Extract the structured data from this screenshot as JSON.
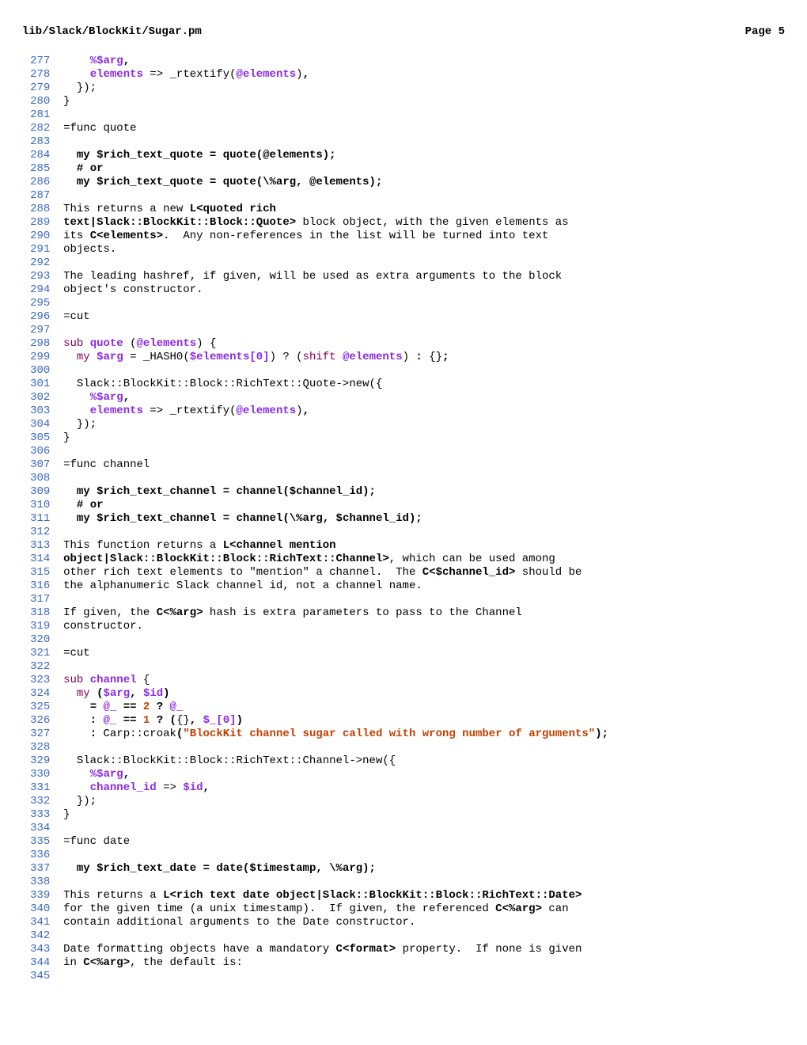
{
  "header": {
    "filepath": "lib/Slack/BlockKit/Sugar.pm",
    "page_label": "Page 5"
  },
  "lines": [
    {
      "n": 277,
      "segs": [
        {
          "t": "    "
        },
        {
          "c": "var",
          "t": "%$arg"
        },
        {
          "c": "bop",
          "t": ","
        }
      ]
    },
    {
      "n": 278,
      "segs": [
        {
          "t": "    "
        },
        {
          "c": "var",
          "t": "elements"
        },
        {
          "t": " => _rtextify("
        },
        {
          "c": "var",
          "t": "@elements"
        },
        {
          "t": ")"
        },
        {
          "c": "bop",
          "t": ","
        }
      ]
    },
    {
      "n": 279,
      "segs": [
        {
          "t": "  });"
        }
      ]
    },
    {
      "n": 280,
      "segs": [
        {
          "t": "}"
        }
      ]
    },
    {
      "n": 281,
      "segs": [
        {
          "t": ""
        }
      ]
    },
    {
      "n": 282,
      "segs": [
        {
          "t": "=func quote"
        }
      ]
    },
    {
      "n": 283,
      "segs": [
        {
          "t": ""
        }
      ]
    },
    {
      "n": 284,
      "segs": [
        {
          "t": "  "
        },
        {
          "c": "podb",
          "t": "my $rich_text_quote = quote(@elements);"
        }
      ]
    },
    {
      "n": 285,
      "segs": [
        {
          "t": "  "
        },
        {
          "c": "podb",
          "t": "# or"
        }
      ]
    },
    {
      "n": 286,
      "segs": [
        {
          "t": "  "
        },
        {
          "c": "podb",
          "t": "my $rich_text_quote = quote(\\%arg, @elements);"
        }
      ]
    },
    {
      "n": 287,
      "segs": [
        {
          "t": ""
        }
      ]
    },
    {
      "n": 288,
      "segs": [
        {
          "t": "This returns a new "
        },
        {
          "c": "podb",
          "t": "L<quoted rich"
        }
      ]
    },
    {
      "n": 289,
      "segs": [
        {
          "c": "podb",
          "t": "text|Slack::BlockKit::Block::Quote>"
        },
        {
          "t": " block object, with the given elements as"
        }
      ]
    },
    {
      "n": 290,
      "segs": [
        {
          "t": "its "
        },
        {
          "c": "podb",
          "t": "C<elements>"
        },
        {
          "t": ".  Any non-references in the list will be turned into text"
        }
      ]
    },
    {
      "n": 291,
      "segs": [
        {
          "t": "objects."
        }
      ]
    },
    {
      "n": 292,
      "segs": [
        {
          "t": ""
        }
      ]
    },
    {
      "n": 293,
      "segs": [
        {
          "t": "The leading hashref, if given, will be used as extra arguments to the block"
        }
      ]
    },
    {
      "n": 294,
      "segs": [
        {
          "t": "object's constructor."
        }
      ]
    },
    {
      "n": 295,
      "segs": [
        {
          "t": ""
        }
      ]
    },
    {
      "n": 296,
      "segs": [
        {
          "t": "=cut"
        }
      ]
    },
    {
      "n": 297,
      "segs": [
        {
          "t": ""
        }
      ]
    },
    {
      "n": 298,
      "segs": [
        {
          "c": "kw",
          "t": "sub "
        },
        {
          "c": "var",
          "t": "quote"
        },
        {
          "t": " ("
        },
        {
          "c": "var",
          "t": "@elements"
        },
        {
          "t": ") {"
        }
      ]
    },
    {
      "n": 299,
      "segs": [
        {
          "t": "  "
        },
        {
          "c": "kw",
          "t": "my"
        },
        {
          "t": " "
        },
        {
          "c": "var",
          "t": "$arg"
        },
        {
          "t": " = _HASH0("
        },
        {
          "c": "var",
          "t": "$elements[0]"
        },
        {
          "t": ") ? ("
        },
        {
          "c": "kw",
          "t": "shift"
        },
        {
          "t": " "
        },
        {
          "c": "var",
          "t": "@elements"
        },
        {
          "t": ")"
        },
        {
          "c": "bop",
          "t": " : "
        },
        {
          "t": "{}"
        },
        {
          "c": "bop",
          "t": ";"
        }
      ]
    },
    {
      "n": 300,
      "segs": [
        {
          "t": ""
        }
      ]
    },
    {
      "n": 301,
      "segs": [
        {
          "t": "  Slack::BlockKit::Block::RichText::Quote->new({"
        }
      ]
    },
    {
      "n": 302,
      "segs": [
        {
          "t": "    "
        },
        {
          "c": "var",
          "t": "%$arg"
        },
        {
          "c": "bop",
          "t": ","
        }
      ]
    },
    {
      "n": 303,
      "segs": [
        {
          "t": "    "
        },
        {
          "c": "var",
          "t": "elements"
        },
        {
          "t": " => _rtextify("
        },
        {
          "c": "var",
          "t": "@elements"
        },
        {
          "t": ")"
        },
        {
          "c": "bop",
          "t": ","
        }
      ]
    },
    {
      "n": 304,
      "segs": [
        {
          "t": "  });"
        }
      ]
    },
    {
      "n": 305,
      "segs": [
        {
          "t": "}"
        }
      ]
    },
    {
      "n": 306,
      "segs": [
        {
          "t": ""
        }
      ]
    },
    {
      "n": 307,
      "segs": [
        {
          "t": "=func channel"
        }
      ]
    },
    {
      "n": 308,
      "segs": [
        {
          "t": ""
        }
      ]
    },
    {
      "n": 309,
      "segs": [
        {
          "t": "  "
        },
        {
          "c": "podb",
          "t": "my $rich_text_channel = channel($channel_id);"
        }
      ]
    },
    {
      "n": 310,
      "segs": [
        {
          "t": "  "
        },
        {
          "c": "podb",
          "t": "# or"
        }
      ]
    },
    {
      "n": 311,
      "segs": [
        {
          "t": "  "
        },
        {
          "c": "podb",
          "t": "my $rich_text_channel = channel(\\%arg, $channel_id);"
        }
      ]
    },
    {
      "n": 312,
      "segs": [
        {
          "t": ""
        }
      ]
    },
    {
      "n": 313,
      "segs": [
        {
          "t": "This function returns a "
        },
        {
          "c": "podb",
          "t": "L<channel mention"
        }
      ]
    },
    {
      "n": 314,
      "segs": [
        {
          "c": "podb",
          "t": "object|Slack::BlockKit::Block::RichText::Channel>"
        },
        {
          "t": ", which can be used among"
        }
      ]
    },
    {
      "n": 315,
      "segs": [
        {
          "t": "other rich text elements to \"mention\" a channel.  The "
        },
        {
          "c": "podb",
          "t": "C<$channel_id>"
        },
        {
          "t": " should be"
        }
      ]
    },
    {
      "n": 316,
      "segs": [
        {
          "t": "the alphanumeric Slack channel id, not a channel name."
        }
      ]
    },
    {
      "n": 317,
      "segs": [
        {
          "t": ""
        }
      ]
    },
    {
      "n": 318,
      "segs": [
        {
          "t": "If given, the "
        },
        {
          "c": "podb",
          "t": "C<%arg>"
        },
        {
          "t": " hash is extra parameters to pass to the Channel"
        }
      ]
    },
    {
      "n": 319,
      "segs": [
        {
          "t": "constructor."
        }
      ]
    },
    {
      "n": 320,
      "segs": [
        {
          "t": ""
        }
      ]
    },
    {
      "n": 321,
      "segs": [
        {
          "t": "=cut"
        }
      ]
    },
    {
      "n": 322,
      "segs": [
        {
          "t": ""
        }
      ]
    },
    {
      "n": 323,
      "segs": [
        {
          "c": "kw",
          "t": "sub "
        },
        {
          "c": "var",
          "t": "channel"
        },
        {
          "t": " {"
        }
      ]
    },
    {
      "n": 324,
      "segs": [
        {
          "t": "  "
        },
        {
          "c": "kw",
          "t": "my"
        },
        {
          "t": " "
        },
        {
          "c": "bop",
          "t": "("
        },
        {
          "c": "var",
          "t": "$arg"
        },
        {
          "c": "bop",
          "t": ", "
        },
        {
          "c": "var",
          "t": "$id"
        },
        {
          "c": "bop",
          "t": ")"
        }
      ]
    },
    {
      "n": 325,
      "segs": [
        {
          "t": "    "
        },
        {
          "c": "bop",
          "t": "= "
        },
        {
          "c": "var",
          "t": "@_"
        },
        {
          "c": "bop",
          "t": " == "
        },
        {
          "c": "num",
          "t": "2"
        },
        {
          "c": "bop",
          "t": " ? "
        },
        {
          "c": "var",
          "t": "@_"
        }
      ]
    },
    {
      "n": 326,
      "segs": [
        {
          "t": "    "
        },
        {
          "c": "bop",
          "t": ": "
        },
        {
          "c": "var",
          "t": "@_"
        },
        {
          "c": "bop",
          "t": " == "
        },
        {
          "c": "num",
          "t": "1"
        },
        {
          "c": "bop",
          "t": " ? ("
        },
        {
          "t": "{}"
        },
        {
          "c": "bop",
          "t": ", "
        },
        {
          "c": "var",
          "t": "$_[0]"
        },
        {
          "c": "bop",
          "t": ")"
        }
      ]
    },
    {
      "n": 327,
      "segs": [
        {
          "t": "    "
        },
        {
          "c": "bop",
          "t": ": "
        },
        {
          "t": "Carp::croak"
        },
        {
          "c": "bop",
          "t": "("
        },
        {
          "c": "str",
          "t": "\"BlockKit channel sugar called with wrong number of arguments\""
        },
        {
          "c": "bop",
          "t": ");"
        }
      ]
    },
    {
      "n": 328,
      "segs": [
        {
          "t": ""
        }
      ]
    },
    {
      "n": 329,
      "segs": [
        {
          "t": "  Slack::BlockKit::Block::RichText::Channel->new({"
        }
      ]
    },
    {
      "n": 330,
      "segs": [
        {
          "t": "    "
        },
        {
          "c": "var",
          "t": "%$arg"
        },
        {
          "c": "bop",
          "t": ","
        }
      ]
    },
    {
      "n": 331,
      "segs": [
        {
          "t": "    "
        },
        {
          "c": "var",
          "t": "channel_id"
        },
        {
          "t": " => "
        },
        {
          "c": "var",
          "t": "$id"
        },
        {
          "c": "bop",
          "t": ","
        }
      ]
    },
    {
      "n": 332,
      "segs": [
        {
          "t": "  });"
        }
      ]
    },
    {
      "n": 333,
      "segs": [
        {
          "t": "}"
        }
      ]
    },
    {
      "n": 334,
      "segs": [
        {
          "t": ""
        }
      ]
    },
    {
      "n": 335,
      "segs": [
        {
          "t": "=func date"
        }
      ]
    },
    {
      "n": 336,
      "segs": [
        {
          "t": ""
        }
      ]
    },
    {
      "n": 337,
      "segs": [
        {
          "t": "  "
        },
        {
          "c": "podb",
          "t": "my $rich_text_date = date($timestamp, \\%arg);"
        }
      ]
    },
    {
      "n": 338,
      "segs": [
        {
          "t": ""
        }
      ]
    },
    {
      "n": 339,
      "segs": [
        {
          "t": "This returns a "
        },
        {
          "c": "podb",
          "t": "L<rich text date object|Slack::BlockKit::Block::RichText::Date>"
        }
      ]
    },
    {
      "n": 340,
      "segs": [
        {
          "t": "for the given time (a unix timestamp).  If given, the referenced "
        },
        {
          "c": "podb",
          "t": "C<%arg>"
        },
        {
          "t": " can"
        }
      ]
    },
    {
      "n": 341,
      "segs": [
        {
          "t": "contain additional arguments to the Date constructor."
        }
      ]
    },
    {
      "n": 342,
      "segs": [
        {
          "t": ""
        }
      ]
    },
    {
      "n": 343,
      "segs": [
        {
          "t": "Date formatting objects have a mandatory "
        },
        {
          "c": "podb",
          "t": "C<format>"
        },
        {
          "t": " property.  If none is given"
        }
      ]
    },
    {
      "n": 344,
      "segs": [
        {
          "t": "in "
        },
        {
          "c": "podb",
          "t": "C<%arg>"
        },
        {
          "t": ", the default is:"
        }
      ]
    },
    {
      "n": 345,
      "segs": [
        {
          "t": ""
        }
      ]
    }
  ]
}
